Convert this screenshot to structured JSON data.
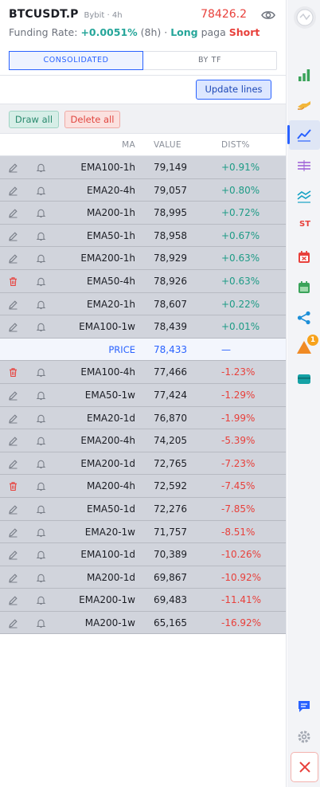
{
  "header": {
    "symbol": "BTCUSDT.P",
    "exchange": "Bybit · 4h",
    "price": "78426.2",
    "funding_label": "Funding Rate: ",
    "funding_pct": "+0.0051%",
    "funding_period": " (8h) · ",
    "long_label": "Long",
    "paga_label": " paga ",
    "short_label": "Short"
  },
  "tabs": [
    {
      "label": "CONSOLIDATED",
      "active": true
    },
    {
      "label": "BY TF",
      "active": false
    }
  ],
  "update_button": "Update lines",
  "toolbar": {
    "draw_all": "Draw all",
    "delete_all": "Delete all"
  },
  "table": {
    "headers": {
      "ma": "MA",
      "value": "VALUE",
      "dist": "DIST%"
    },
    "rows_above": [
      {
        "icon": "pencil",
        "ma": "EMA100-1h",
        "value": "79,149",
        "dist": "+0.91%"
      },
      {
        "icon": "pencil",
        "ma": "EMA20-4h",
        "value": "79,057",
        "dist": "+0.80%"
      },
      {
        "icon": "pencil",
        "ma": "MA200-1h",
        "value": "78,995",
        "dist": "+0.72%"
      },
      {
        "icon": "pencil",
        "ma": "EMA50-1h",
        "value": "78,958",
        "dist": "+0.67%"
      },
      {
        "icon": "pencil",
        "ma": "EMA200-1h",
        "value": "78,929",
        "dist": "+0.63%"
      },
      {
        "icon": "trash",
        "ma": "EMA50-4h",
        "value": "78,926",
        "dist": "+0.63%"
      },
      {
        "icon": "pencil",
        "ma": "EMA20-1h",
        "value": "78,607",
        "dist": "+0.22%"
      },
      {
        "icon": "pencil",
        "ma": "EMA100-1w",
        "value": "78,439",
        "dist": "+0.01%"
      }
    ],
    "price_row": {
      "label": "PRICE",
      "value": "78,433",
      "dist": "—"
    },
    "rows_below": [
      {
        "icon": "trash",
        "ma": "EMA100-4h",
        "value": "77,466",
        "dist": "-1.23%"
      },
      {
        "icon": "pencil",
        "ma": "EMA50-1w",
        "value": "77,424",
        "dist": "-1.29%"
      },
      {
        "icon": "pencil",
        "ma": "EMA20-1d",
        "value": "76,870",
        "dist": "-1.99%"
      },
      {
        "icon": "pencil",
        "ma": "EMA200-4h",
        "value": "74,205",
        "dist": "-5.39%"
      },
      {
        "icon": "pencil",
        "ma": "EMA200-1d",
        "value": "72,765",
        "dist": "-7.23%"
      },
      {
        "icon": "trash",
        "ma": "MA200-4h",
        "value": "72,592",
        "dist": "-7.45%"
      },
      {
        "icon": "pencil",
        "ma": "EMA50-1d",
        "value": "72,276",
        "dist": "-7.85%"
      },
      {
        "icon": "pencil",
        "ma": "EMA20-1w",
        "value": "71,757",
        "dist": "-8.51%"
      },
      {
        "icon": "pencil",
        "ma": "EMA100-1d",
        "value": "70,389",
        "dist": "-10.26%"
      },
      {
        "icon": "pencil",
        "ma": "MA200-1d",
        "value": "69,867",
        "dist": "-10.92%"
      },
      {
        "icon": "pencil",
        "ma": "EMA200-1w",
        "value": "69,483",
        "dist": "-11.41%"
      },
      {
        "icon": "pencil",
        "ma": "MA200-1w",
        "value": "65,165",
        "dist": "-16.92%"
      }
    ]
  },
  "sidebar": {
    "icons": [
      "bar-chart-icon",
      "hand-icon",
      "trend-line-icon",
      "horizontal-lines-icon",
      "wave-icon",
      "st-icon",
      "calendar-x-icon",
      "calendar-icon",
      "share-icon",
      "alert-triangle-icon",
      "card-icon",
      "chat-icon",
      "gear-icon",
      "close-icon"
    ],
    "st_label": "ST",
    "badge_count": "1"
  },
  "colors": {
    "positive": "#1e9b86",
    "negative": "#e8403b",
    "accent": "#2962ff"
  }
}
